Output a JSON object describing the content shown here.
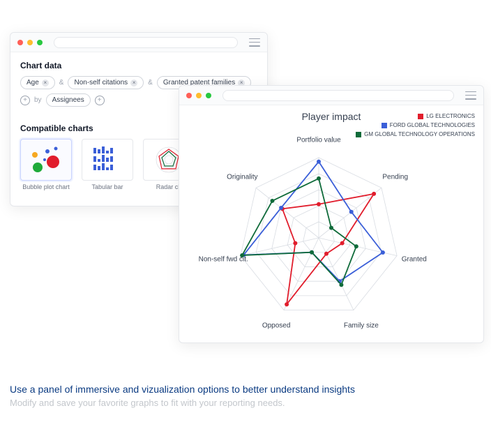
{
  "window_back": {
    "chart_data_title": "Chart data",
    "pills": {
      "age": "Age",
      "nonself": "Non-self citations",
      "granted": "Granted patent families",
      "by": "by",
      "assignees": "Assignees"
    },
    "compatible_title": "Compatible charts",
    "cards": {
      "bubble": "Bubble plot chart",
      "tabular": "Tabular bar",
      "radar": "Radar ch"
    }
  },
  "window_front": {
    "title": "Player impact",
    "legend": {
      "lg": "LG ELECTRONICS",
      "ford": "FORD GLOBAL TECHNOLOGIES",
      "gm": "GM GLOBAL TECHNOLOGY OPERATIONS"
    },
    "colors": {
      "lg": "#e11d2c",
      "ford": "#3b5fd8",
      "gm": "#0f6b3a"
    },
    "axes": {
      "portfolio": "Portfolio value",
      "pending": "Pending",
      "granted": "Granted",
      "family": "Family size",
      "opposed": "Opposed",
      "nonself": "Non-self fwd cit.",
      "originality": "Originality"
    }
  },
  "caption": {
    "headline": "Use a panel of immersive and vizualization options to better understand insights",
    "sub": "Modify and save your favorite graphs to fit with your reporting needs."
  },
  "chart_data": {
    "type": "radar",
    "title": "Player impact",
    "axes": [
      "Portfolio value",
      "Pending",
      "Granted",
      "Family size",
      "Opposed",
      "Non-self fwd cit.",
      "Originality"
    ],
    "range": [
      0,
      100
    ],
    "series": [
      {
        "name": "LG ELECTRONICS",
        "color": "#e11d2c",
        "values": [
          42,
          88,
          30,
          22,
          92,
          30,
          58
        ]
      },
      {
        "name": "FORD GLOBAL TECHNOLOGIES",
        "color": "#3b5fd8",
        "values": [
          95,
          52,
          82,
          60,
          20,
          96,
          60
        ]
      },
      {
        "name": "GM GLOBAL TECHNOLOGY OPERATIONS",
        "color": "#0f6b3a",
        "values": [
          74,
          20,
          48,
          65,
          20,
          98,
          74
        ]
      }
    ]
  }
}
